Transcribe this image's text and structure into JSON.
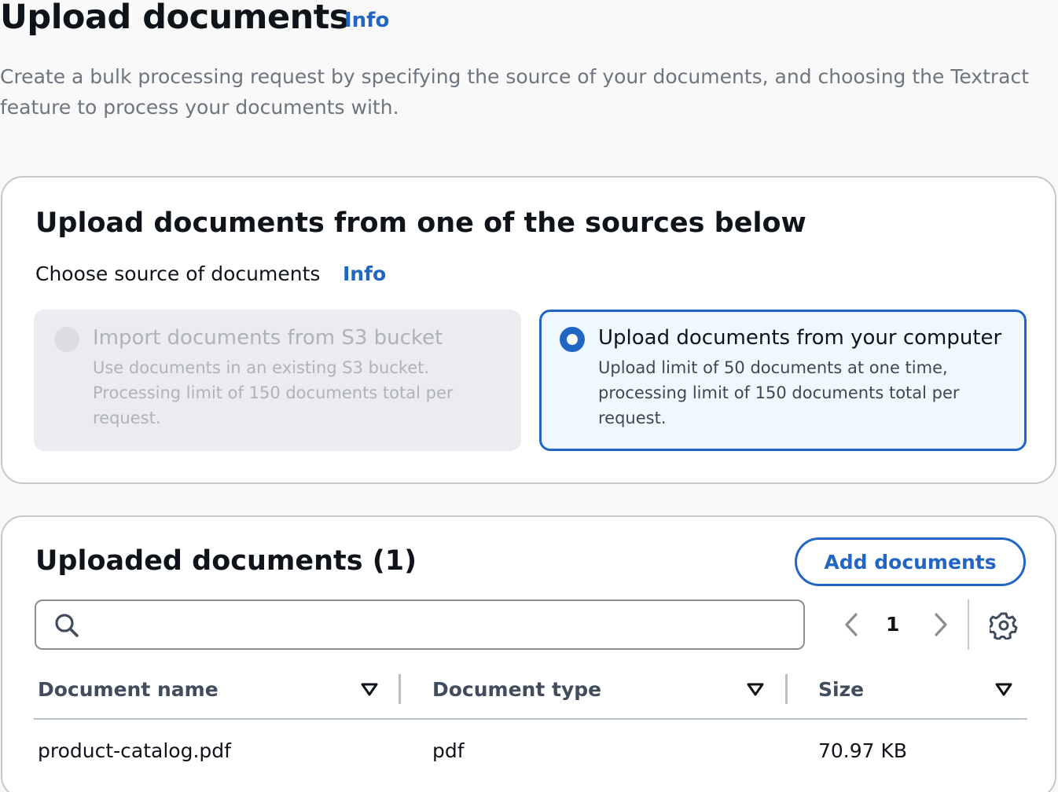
{
  "header": {
    "title": "Upload documents",
    "info_link": "Info",
    "description": "Create a bulk processing request by specifying the source of your documents, and choosing the Textract feature to process your documents with."
  },
  "source_panel": {
    "title": "Upload documents from one of the sources below",
    "choose_label": "Choose source of documents",
    "info_link": "Info",
    "options": [
      {
        "title": "Import documents from S3 bucket",
        "description": "Use documents in an existing S3 bucket. Processing limit of 150 documents total per request.",
        "disabled": true,
        "selected": false
      },
      {
        "title": "Upload documents from your computer",
        "description": "Upload limit of 50 documents at one time, processing limit of 150 documents total per request.",
        "disabled": false,
        "selected": true
      }
    ]
  },
  "documents_panel": {
    "title": "Uploaded documents (1)",
    "add_button": "Add documents",
    "search": {
      "value": "",
      "placeholder": ""
    },
    "pagination": {
      "current_page": "1"
    },
    "columns": [
      "Document name",
      "Document type",
      "Size"
    ],
    "rows": [
      [
        "product-catalog.pdf",
        "pdf",
        "70.97 KB"
      ]
    ]
  },
  "colors": {
    "accent": "#2166c5",
    "selected_tile_bg": "#f0f8ff",
    "disabled_tile_bg": "#ebebf0",
    "page_bg": "#f9f9fa"
  },
  "icons": {
    "search": "search-icon",
    "prev": "chevron-left-icon",
    "next": "chevron-right-icon",
    "settings": "gear-icon",
    "sort": "caret-down-icon"
  }
}
